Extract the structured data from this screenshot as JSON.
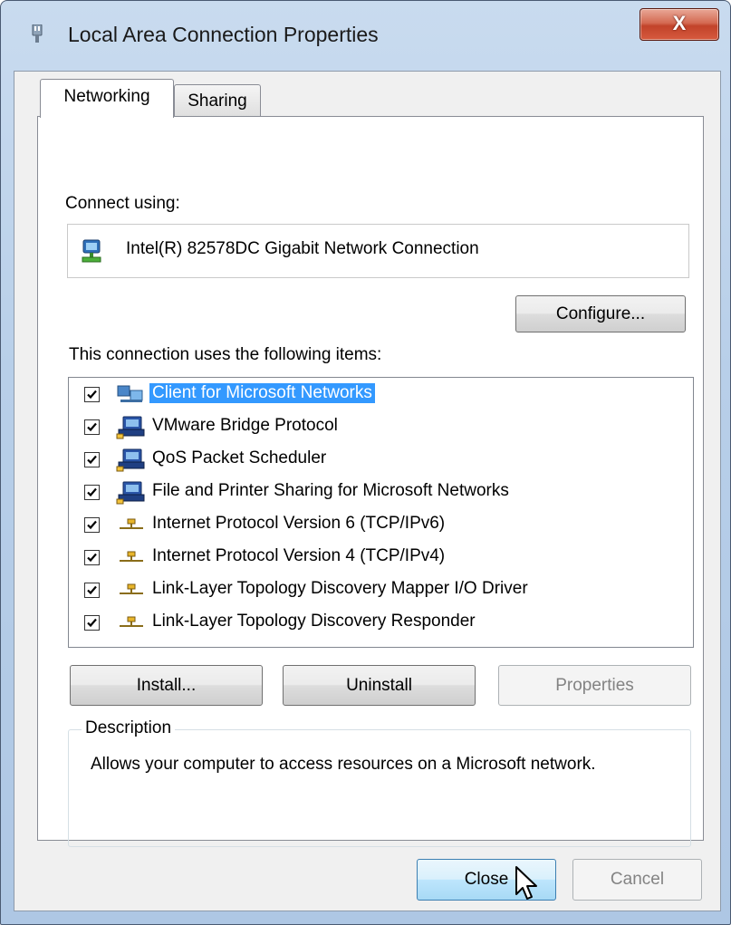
{
  "window": {
    "title": "Local Area Connection Properties",
    "close_glyph": "X",
    "accent_close": "#c7462a"
  },
  "tabs": [
    {
      "label": "Networking",
      "selected": true
    },
    {
      "label": "Sharing",
      "selected": false
    }
  ],
  "connect_using": {
    "label": "Connect using:",
    "adapter_icon": "network-adapter-icon",
    "adapter_name": "Intel(R) 82578DC Gigabit Network Connection",
    "configure_label": "Configure..."
  },
  "items_section": {
    "label": "This connection uses the following items:",
    "items": [
      {
        "label": "Client for Microsoft Networks",
        "checked": true,
        "icon": "network-client-icon",
        "selected": true
      },
      {
        "label": "VMware Bridge Protocol",
        "checked": true,
        "icon": "computer-service-icon",
        "selected": false
      },
      {
        "label": "QoS Packet Scheduler",
        "checked": true,
        "icon": "computer-service-icon",
        "selected": false
      },
      {
        "label": "File and Printer Sharing for Microsoft Networks",
        "checked": true,
        "icon": "computer-service-icon",
        "selected": false
      },
      {
        "label": "Internet Protocol Version 6 (TCP/IPv6)",
        "checked": true,
        "icon": "protocol-icon",
        "selected": false
      },
      {
        "label": "Internet Protocol Version 4 (TCP/IPv4)",
        "checked": true,
        "icon": "protocol-icon",
        "selected": false
      },
      {
        "label": "Link-Layer Topology Discovery Mapper I/O Driver",
        "checked": true,
        "icon": "protocol-icon",
        "selected": false
      },
      {
        "label": "Link-Layer Topology Discovery Responder",
        "checked": true,
        "icon": "protocol-icon",
        "selected": false
      }
    ]
  },
  "buttons": {
    "install": "Install...",
    "uninstall": "Uninstall",
    "properties": "Properties",
    "close": "Close",
    "cancel": "Cancel"
  },
  "description": {
    "legend": "Description",
    "text": "Allows your computer to access resources on a Microsoft network."
  },
  "colors": {
    "selection": "#3399ff",
    "dialog_bg": "#f0f0f0"
  }
}
